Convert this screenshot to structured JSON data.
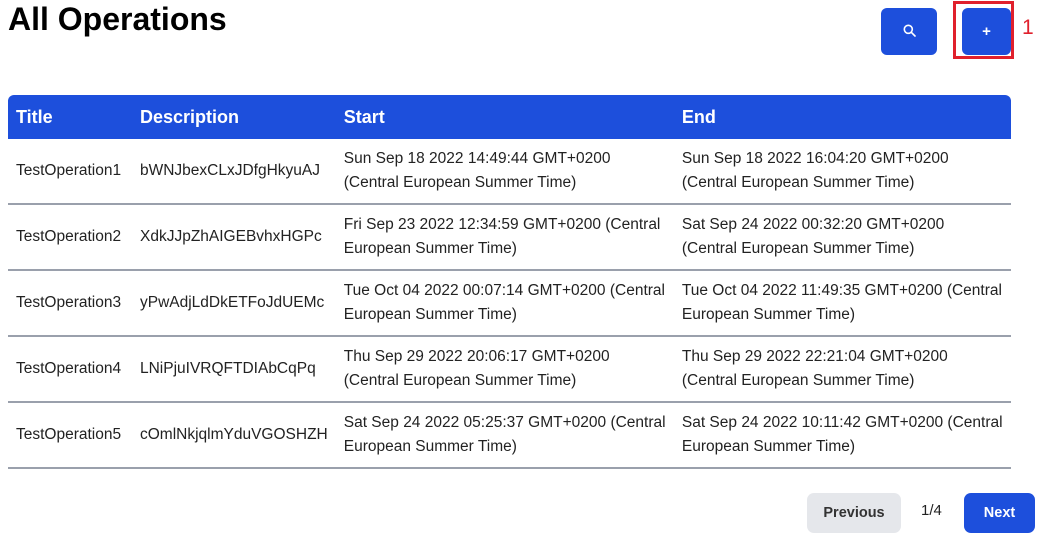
{
  "page": {
    "title": "All Operations"
  },
  "toolbar": {
    "search_icon": "search-icon",
    "add_label": "+"
  },
  "annotation": {
    "label": "1",
    "color": "#e0202c"
  },
  "table": {
    "headers": [
      "Title",
      "Description",
      "Start",
      "End"
    ],
    "rows": [
      {
        "title": "TestOperation1",
        "description": "bWNJbexCLxJDfgHkyuAJ",
        "start": "Sun Sep 18 2022 14:49:44 GMT+0200 (Central European Summer Time)",
        "end": "Sun Sep 18 2022 16:04:20 GMT+0200 (Central European Summer Time)"
      },
      {
        "title": "TestOperation2",
        "description": "XdkJJpZhAIGEBvhxHGPc",
        "start": "Fri Sep 23 2022 12:34:59 GMT+0200 (Central European Summer Time)",
        "end": "Sat Sep 24 2022 00:32:20 GMT+0200 (Central European Summer Time)"
      },
      {
        "title": "TestOperation3",
        "description": "yPwAdjLdDkETFoJdUEMc",
        "start": "Tue Oct 04 2022 00:07:14 GMT+0200 (Central European Summer Time)",
        "end": "Tue Oct 04 2022 11:49:35 GMT+0200 (Central European Summer Time)"
      },
      {
        "title": "TestOperation4",
        "description": "LNiPjuIVRQFTDIAbCqPq",
        "start": "Thu Sep 29 2022 20:06:17 GMT+0200 (Central European Summer Time)",
        "end": "Thu Sep 29 2022 22:21:04 GMT+0200 (Central European Summer Time)"
      },
      {
        "title": "TestOperation5",
        "description": "cOmlNkjqlmYduVGOSHZH",
        "start": "Sat Sep 24 2022 05:25:37 GMT+0200 (Central European Summer Time)",
        "end": "Sat Sep 24 2022 10:11:42 GMT+0200 (Central European Summer Time)"
      }
    ]
  },
  "pagination": {
    "previous_label": "Previous",
    "page_indicator": "1/4",
    "next_label": "Next"
  },
  "colors": {
    "accent": "#1d4fdc",
    "secondary_button": "#e5e7eb",
    "row_divider": "#9aa0ac"
  }
}
